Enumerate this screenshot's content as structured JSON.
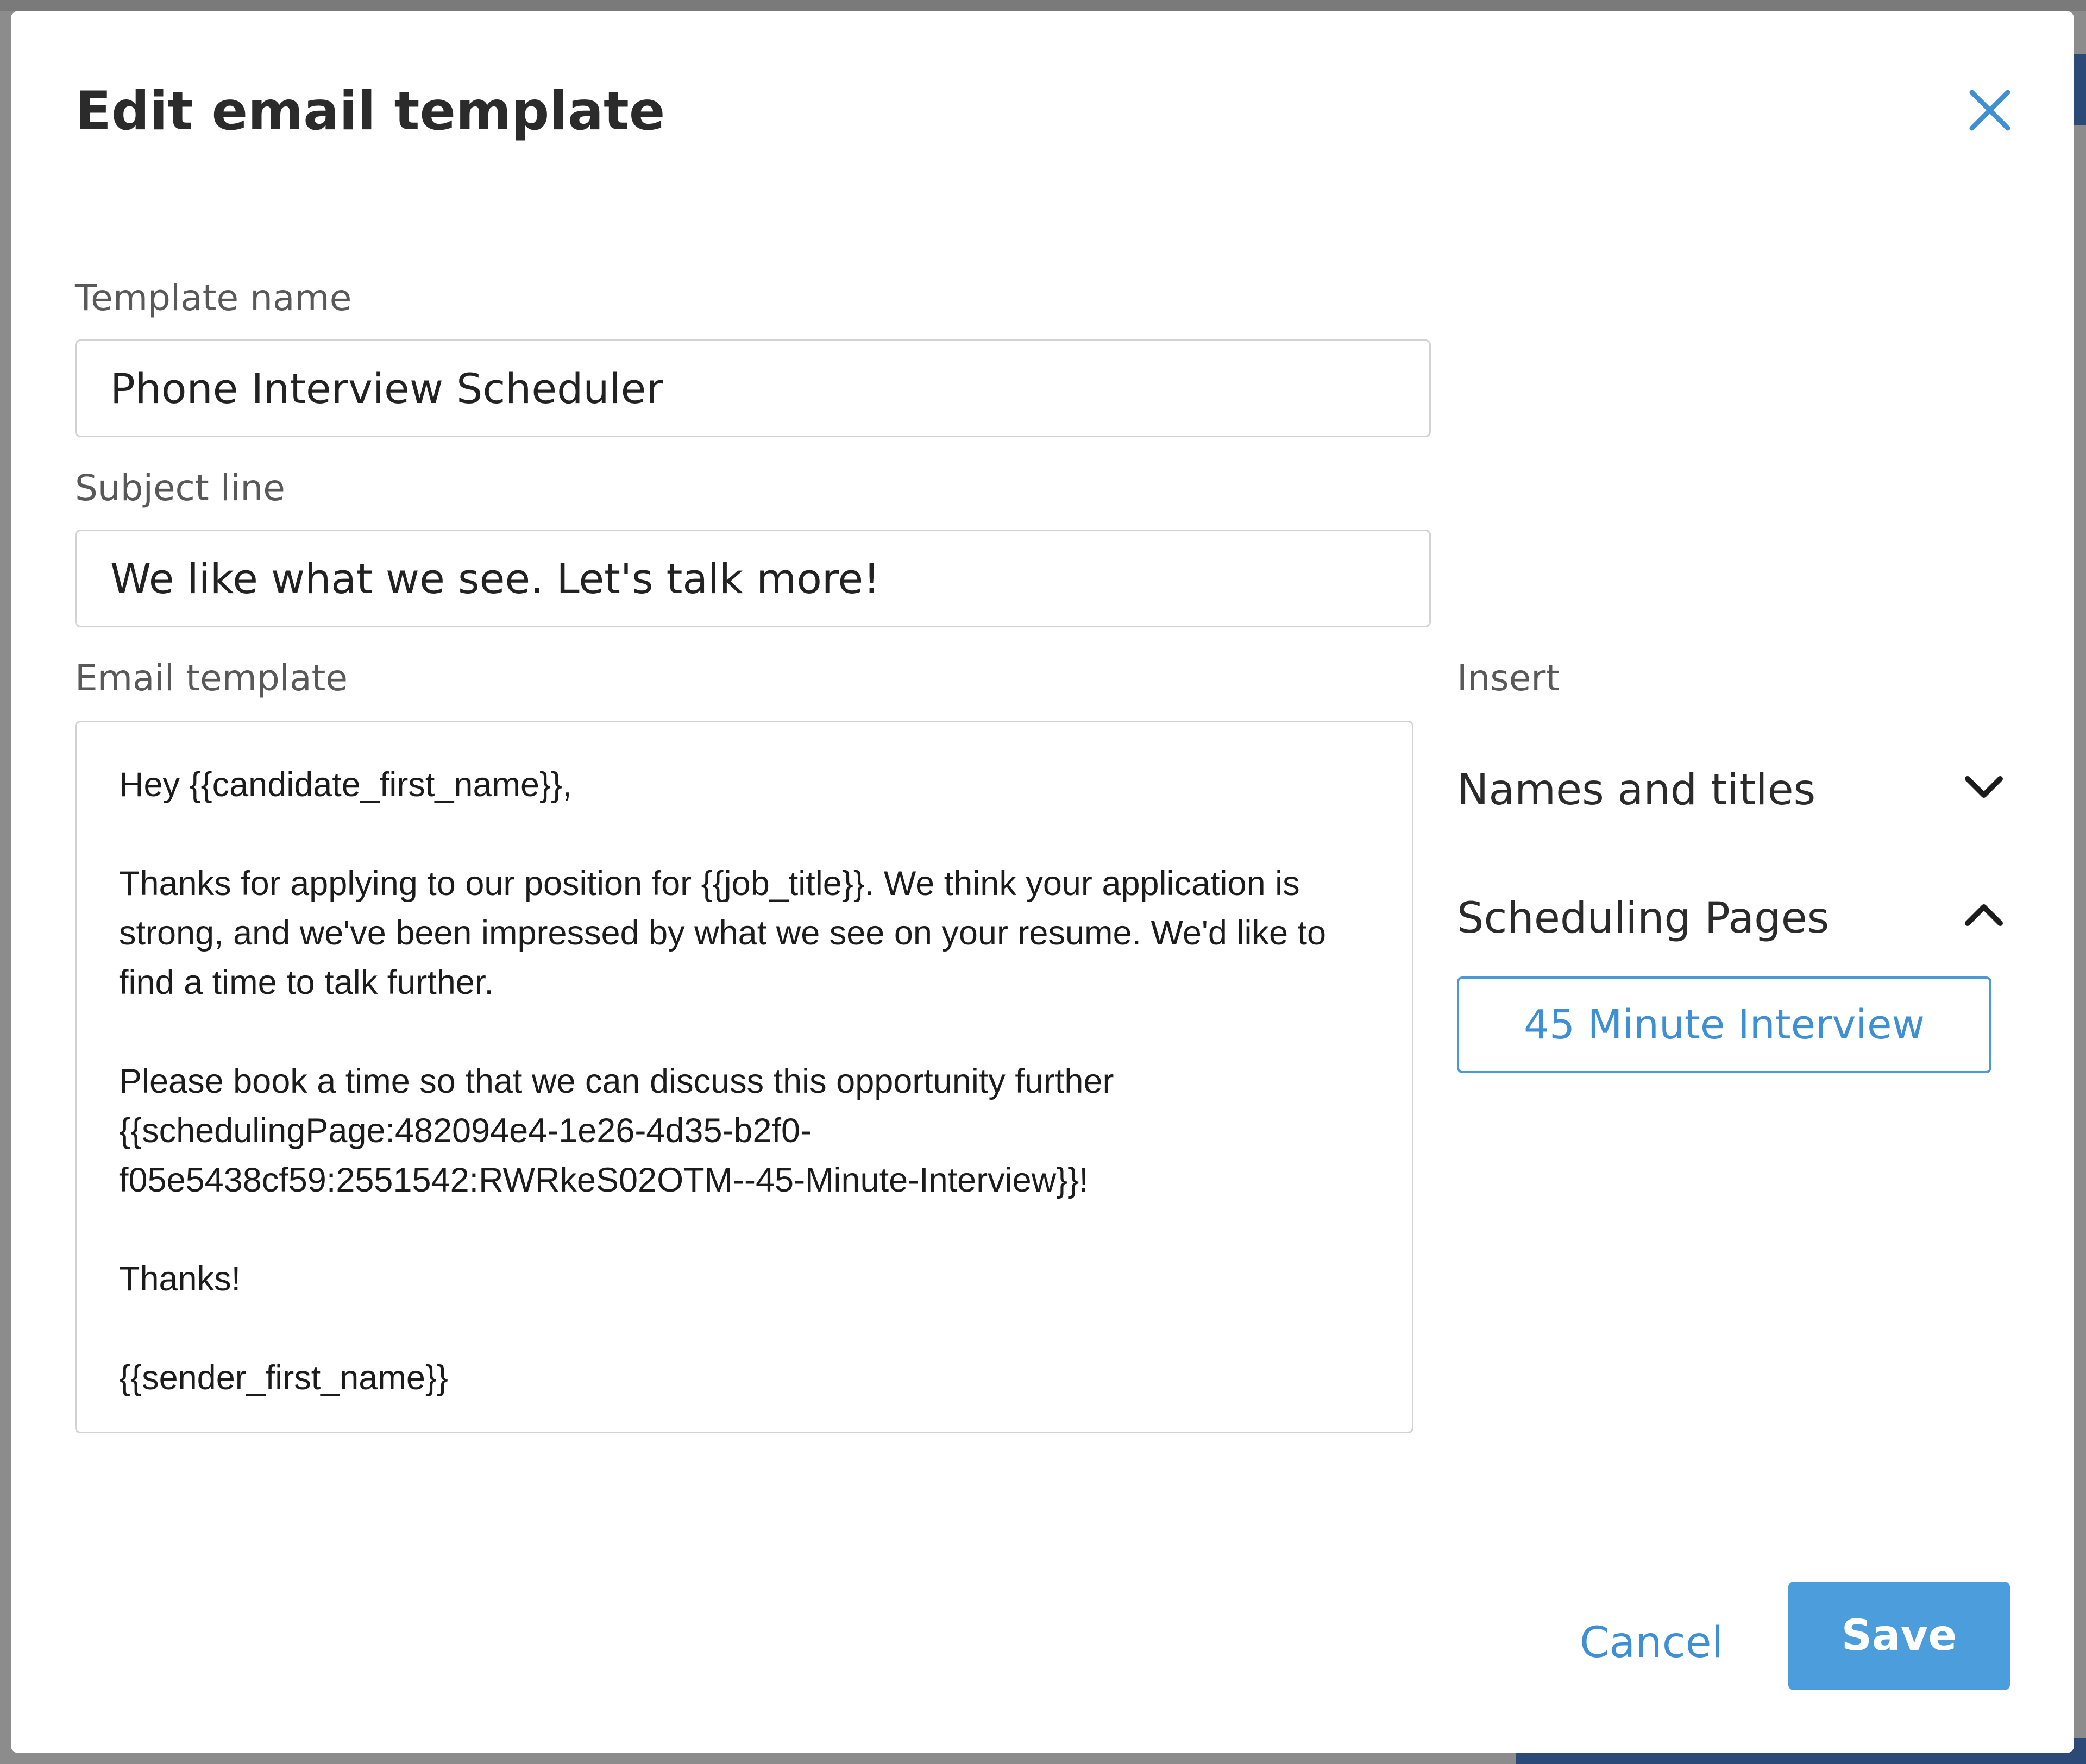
{
  "modal": {
    "title": "Edit email template"
  },
  "template_name": {
    "label": "Template name",
    "value": "Phone Interview Scheduler"
  },
  "subject_line": {
    "label": "Subject line",
    "value": "We like what we see. Let's talk more!"
  },
  "email_template": {
    "label": "Email template",
    "paragraphs": [
      "Hey {{candidate_first_name}},",
      "Thanks for applying to our position for {{job_title}}. We think your application is strong, and we've been impressed by what we see on your resume. We'd like to find a time to talk further.",
      "Please book a time so that we can discuss this opportunity further {{schedulingPage:482094e4-1e26-4d35-b2f0-f05e5438cf59:2551542:RWRkeS02OTM--45-Minute-Interview}}!",
      "Thanks!",
      "{{sender_first_name}}"
    ]
  },
  "insert": {
    "label": "Insert",
    "sections": [
      {
        "label": "Names and titles",
        "expanded": false
      },
      {
        "label": "Scheduling Pages",
        "expanded": true
      }
    ],
    "scheduling_pages": [
      "45 Minute Interview"
    ]
  },
  "actions": {
    "cancel_label": "Cancel",
    "save_label": "Save"
  },
  "colors": {
    "accent": "#4c9ddc",
    "link": "#3e8fd4"
  },
  "icons": {
    "close": "close-icon",
    "collapsed": "chevron-down-icon",
    "expanded": "chevron-up-icon"
  }
}
